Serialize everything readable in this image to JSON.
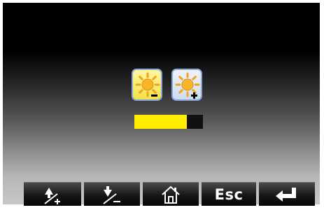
{
  "brightness": {
    "decrease_icon": "sun-minus-icon",
    "increase_icon": "sun-plus-icon",
    "selected": "decrease",
    "level_fraction": 0.77,
    "fill_color": "#ffee00"
  },
  "toolbar": {
    "buttons": [
      {
        "icon": "up-plus-icon"
      },
      {
        "icon": "down-minus-icon"
      },
      {
        "icon": "home-icon"
      },
      {
        "icon": "esc-key",
        "label": "Esc"
      },
      {
        "icon": "enter-arrow-icon"
      }
    ]
  }
}
